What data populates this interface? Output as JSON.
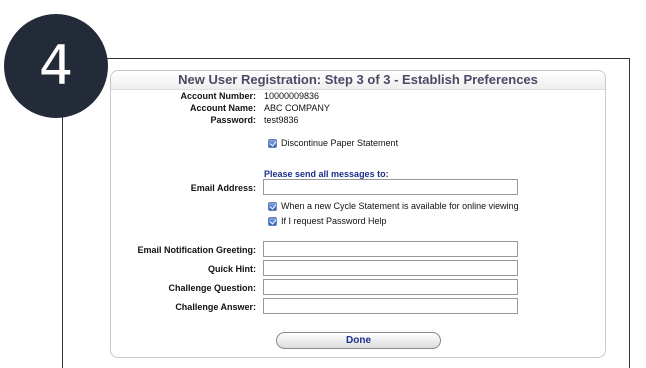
{
  "step_badge": "4",
  "panel": {
    "title": "New User Registration: Step 3 of 3 - Establish Preferences"
  },
  "account": {
    "number_label": "Account Number:",
    "number_value": "10000009836",
    "name_label": "Account Name:",
    "name_value": "ABC COMPANY",
    "password_label": "Password:",
    "password_value": "test9836"
  },
  "paper_statement": {
    "label": "Discontinue Paper Statement",
    "checked": true
  },
  "messages": {
    "heading": "Please send all messages to:",
    "email_label": "Email Address:",
    "email_value": "",
    "notify_cycle_label": "When a new Cycle Statement is available for online viewing",
    "notify_cycle_checked": true,
    "notify_password_label": "If I request Password Help",
    "notify_password_checked": true
  },
  "security": {
    "greeting_label": "Email Notification Greeting:",
    "greeting_value": "",
    "hint_label": "Quick Hint:",
    "hint_value": "",
    "question_label": "Challenge Question:",
    "question_value": "",
    "answer_label": "Challenge Answer:",
    "answer_value": ""
  },
  "done_label": "Done",
  "colors": {
    "badge_bg": "#242b38",
    "title_text": "#4a4a66",
    "link_blue": "#1c2f8a",
    "checkbox_blue": "#2f62c9"
  }
}
